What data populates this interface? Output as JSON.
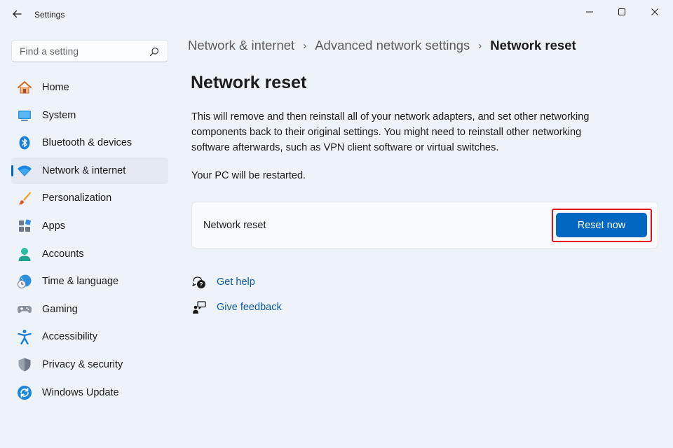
{
  "window": {
    "title": "Settings"
  },
  "search": {
    "placeholder": "Find a setting"
  },
  "sidebar": {
    "items": [
      {
        "label": "Home",
        "icon": "home-icon"
      },
      {
        "label": "System",
        "icon": "system-icon"
      },
      {
        "label": "Bluetooth & devices",
        "icon": "bluetooth-icon"
      },
      {
        "label": "Network & internet",
        "icon": "wifi-icon",
        "selected": true
      },
      {
        "label": "Personalization",
        "icon": "brush-icon"
      },
      {
        "label": "Apps",
        "icon": "apps-icon"
      },
      {
        "label": "Accounts",
        "icon": "accounts-icon"
      },
      {
        "label": "Time & language",
        "icon": "clock-globe-icon"
      },
      {
        "label": "Gaming",
        "icon": "gamepad-icon"
      },
      {
        "label": "Accessibility",
        "icon": "accessibility-icon"
      },
      {
        "label": "Privacy & security",
        "icon": "shield-icon"
      },
      {
        "label": "Windows Update",
        "icon": "update-icon"
      }
    ]
  },
  "breadcrumb": {
    "items": [
      "Network & internet",
      "Advanced network settings"
    ],
    "current": "Network reset"
  },
  "main": {
    "title": "Network reset",
    "description": "This will remove and then reinstall all of your network adapters, and set other networking components back to their original settings. You might need to reinstall other networking software afterwards, such as VPN client software or virtual switches.",
    "restart_note": "Your PC will be restarted.",
    "reset_card": {
      "label": "Network reset",
      "button_label": "Reset now"
    },
    "links": {
      "get_help": "Get help",
      "give_feedback": "Give feedback"
    }
  },
  "colors": {
    "accent": "#0067c0",
    "highlight": "#e8141b",
    "link": "#0a5bb0",
    "background": "#eef2f9"
  }
}
